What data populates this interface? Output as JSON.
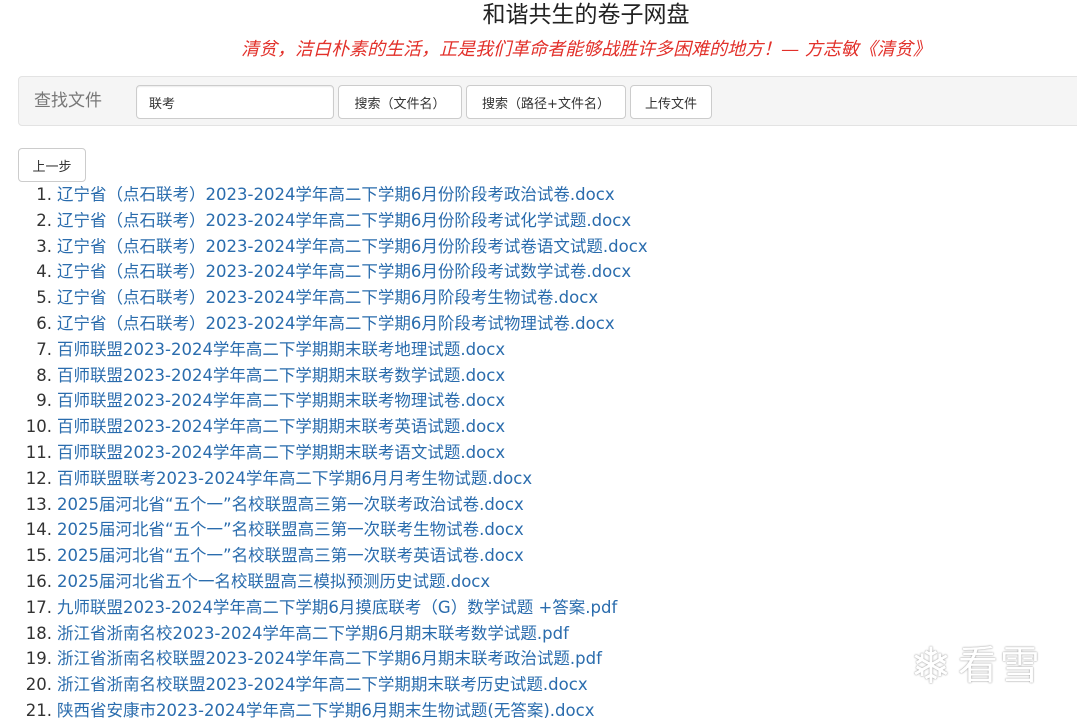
{
  "site_title": "和谐共生的卷子网盘",
  "motto": "清贫，洁白朴素的生活，正是我们革命者能够战胜许多困难的地方！— 方志敏《清贫》",
  "search": {
    "label": "查找文件",
    "value": "联考",
    "search_name_button": "搜索（文件名）",
    "search_path_button": "搜索（路径+文件名）",
    "upload_button": "上传文件"
  },
  "back_button": "上一步",
  "files": [
    {
      "num": "1.",
      "name": "辽宁省（点石联考）2023-2024学年高二下学期6月份阶段考政治试卷.docx"
    },
    {
      "num": "2.",
      "name": "辽宁省（点石联考）2023-2024学年高二下学期6月份阶段考试化学试题.docx"
    },
    {
      "num": "3.",
      "name": "辽宁省（点石联考）2023-2024学年高二下学期6月份阶段考试卷语文试题.docx"
    },
    {
      "num": "4.",
      "name": "辽宁省（点石联考）2023-2024学年高二下学期6月份阶段考试数学试卷.docx"
    },
    {
      "num": "5.",
      "name": "辽宁省（点石联考）2023-2024学年高二下学期6月阶段考生物试卷.docx"
    },
    {
      "num": "6.",
      "name": "辽宁省（点石联考）2023-2024学年高二下学期6月阶段考试物理试卷.docx"
    },
    {
      "num": "7.",
      "name": "百师联盟2023-2024学年高二下学期期末联考地理试题.docx"
    },
    {
      "num": "8.",
      "name": "百师联盟2023-2024学年高二下学期期末联考数学试题.docx"
    },
    {
      "num": "9.",
      "name": "百师联盟2023-2024学年高二下学期期末联考物理试卷.docx"
    },
    {
      "num": "10.",
      "name": "百师联盟2023-2024学年高二下学期期末联考英语试题.docx"
    },
    {
      "num": "11.",
      "name": "百师联盟2023-2024学年高二下学期期末联考语文试题.docx"
    },
    {
      "num": "12.",
      "name": "百师联盟联考2023-2024学年高二下学期6月月考生物试题.docx"
    },
    {
      "num": "13.",
      "name": "2025届河北省“五个一”名校联盟高三第一次联考政治试卷.docx"
    },
    {
      "num": "14.",
      "name": "2025届河北省“五个一”名校联盟高三第一次联考生物试卷.docx"
    },
    {
      "num": "15.",
      "name": "2025届河北省“五个一”名校联盟高三第一次联考英语试卷.docx"
    },
    {
      "num": "16.",
      "name": "2025届河北省五个一名校联盟高三模拟预测历史试题.docx"
    },
    {
      "num": "17.",
      "name": "九师联盟2023-2024学年高二下学期6月摸底联考（G）数学试题 +答案.pdf"
    },
    {
      "num": "18.",
      "name": "浙江省浙南名校2023-2024学年高二下学期6月期末联考数学试题.pdf"
    },
    {
      "num": "19.",
      "name": "浙江省浙南名校联盟2023-2024学年高二下学期6月期末联考政治试题.pdf"
    },
    {
      "num": "20.",
      "name": "浙江省浙南名校联盟2023-2024学年高二下学期期末联考历史试题.docx"
    },
    {
      "num": "21.",
      "name": "陕西省安康市2023-2024学年高二下学期6月期末生物试题(无答案).docx"
    }
  ],
  "watermark": {
    "icon": "snowflake-icon",
    "text": "看雪"
  },
  "colors": {
    "link": "#2a6cad",
    "motto": "#e2302a",
    "panel_bg": "#f5f5f5"
  }
}
